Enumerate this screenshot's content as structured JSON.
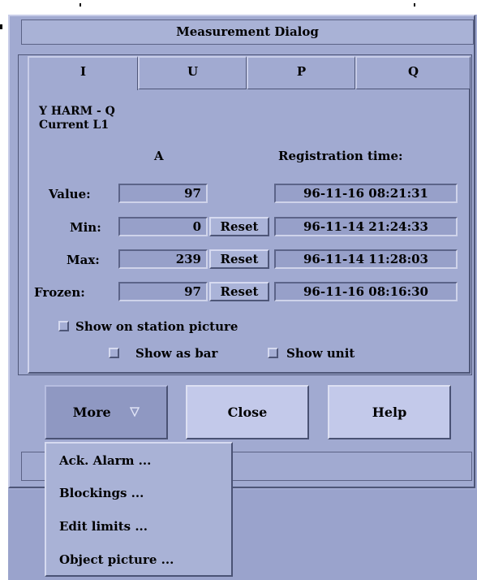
{
  "window": {
    "title": "Measurement Dialog"
  },
  "tabs": [
    {
      "label": "I",
      "active": true
    },
    {
      "label": "U",
      "active": false
    },
    {
      "label": "P",
      "active": false
    },
    {
      "label": "Q",
      "active": false
    }
  ],
  "object": {
    "name": "Y HARM - Q",
    "signal": "Current L1"
  },
  "columns": {
    "unit": "A",
    "registration": "Registration time:"
  },
  "rows": [
    {
      "label": "Value:",
      "value": "97",
      "reset": null,
      "time": "96-11-16 08:21:31"
    },
    {
      "label": "Min:",
      "value": "0",
      "reset": "Reset",
      "time": "96-11-14 21:24:33"
    },
    {
      "label": "Max:",
      "value": "239",
      "reset": "Reset",
      "time": "96-11-14 11:28:03"
    },
    {
      "label": "Frozen:",
      "value": "97",
      "reset": "Reset",
      "time": "96-11-16 08:16:30"
    }
  ],
  "options": {
    "show_on_station_picture": {
      "label": "Show on station picture",
      "checked": false
    },
    "show_as_bar": {
      "label": "Show as bar",
      "checked": false
    },
    "show_unit": {
      "label": "Show unit",
      "checked": false
    }
  },
  "buttons": {
    "more": "More",
    "close": "Close",
    "help": "Help"
  },
  "more_menu": [
    "Ack. Alarm ...",
    "Blockings ...",
    "Edit limits ...",
    "Object picture ..."
  ],
  "colors": {
    "window_bg": "#a1aad1",
    "field_bg": "#97a0c9",
    "button_bg": "#c3c9ea",
    "more_button_bg": "#8f98c2"
  }
}
